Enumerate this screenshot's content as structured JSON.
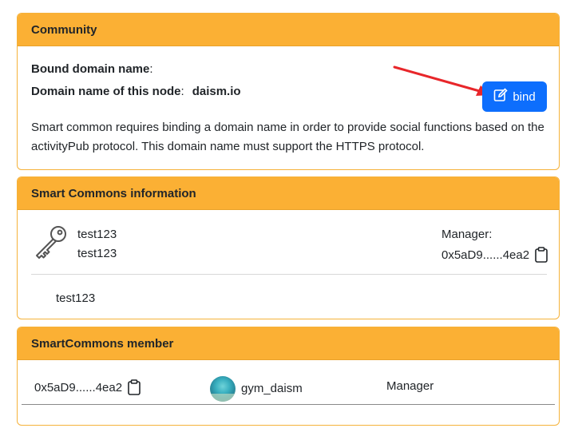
{
  "community": {
    "header": "Community",
    "bound_label": "Bound domain name",
    "bound_colon": ":",
    "node_label": "Domain name of this node",
    "node_colon": ":",
    "node_domain": "daism.io",
    "bind_label": "bind",
    "description": "Smart common requires binding a domain name in order to provide social functions based on the activityPub protocol. This domain name must support the HTTPS protocol."
  },
  "info": {
    "header": "Smart Commons information",
    "name_line1": "test123",
    "name_line2": "test123",
    "manager_label": "Manager:",
    "manager_address": "0x5aD9......4ea2",
    "description": "test123"
  },
  "member": {
    "header": "SmartCommons member",
    "address": "0x5aD9......4ea2",
    "name": "gym_daism",
    "role": "Manager"
  },
  "colors": {
    "header_bg": "#fbb034",
    "border": "#f5b23a",
    "button_bg": "#0d6efd",
    "arrow": "#e8262a"
  },
  "icons": {
    "bind": "edit-icon",
    "key": "key-icon",
    "copy": "clipboard-icon"
  }
}
